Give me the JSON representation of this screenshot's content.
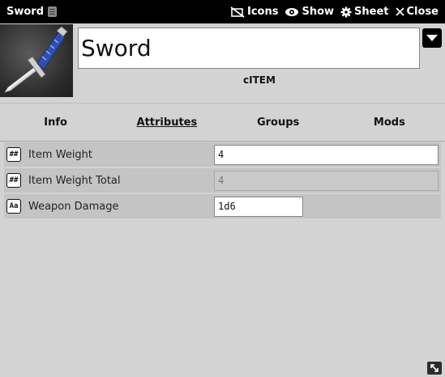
{
  "window": {
    "title": "Sword",
    "actions": [
      {
        "icon": "eye-slash-icon",
        "label": "Icons"
      },
      {
        "icon": "eye-icon",
        "label": "Show"
      },
      {
        "icon": "gear-icon",
        "label": "Sheet"
      },
      {
        "icon": "close-icon",
        "label": "Close"
      }
    ]
  },
  "item": {
    "name": "Sword",
    "type": "cITEM",
    "portrait_icon": "sword-image"
  },
  "tabs": [
    {
      "label": "Info",
      "active": false
    },
    {
      "label": "Attributes",
      "active": true
    },
    {
      "label": "Groups",
      "active": false
    },
    {
      "label": "Mods",
      "active": false
    }
  ],
  "attributes": [
    {
      "badge": "##",
      "label": "Item Weight",
      "value": "4",
      "editable": true
    },
    {
      "badge": "##",
      "label": "Item Weight Total",
      "value": "4",
      "editable": false
    },
    {
      "badge": "Aa",
      "label": "Weapon Damage",
      "value": "1d6",
      "editable": true
    }
  ],
  "colors": {
    "titlebar_bg": "#000000",
    "panel_bg": "#d3d3d3",
    "row_shade": "#c4c4c4"
  }
}
